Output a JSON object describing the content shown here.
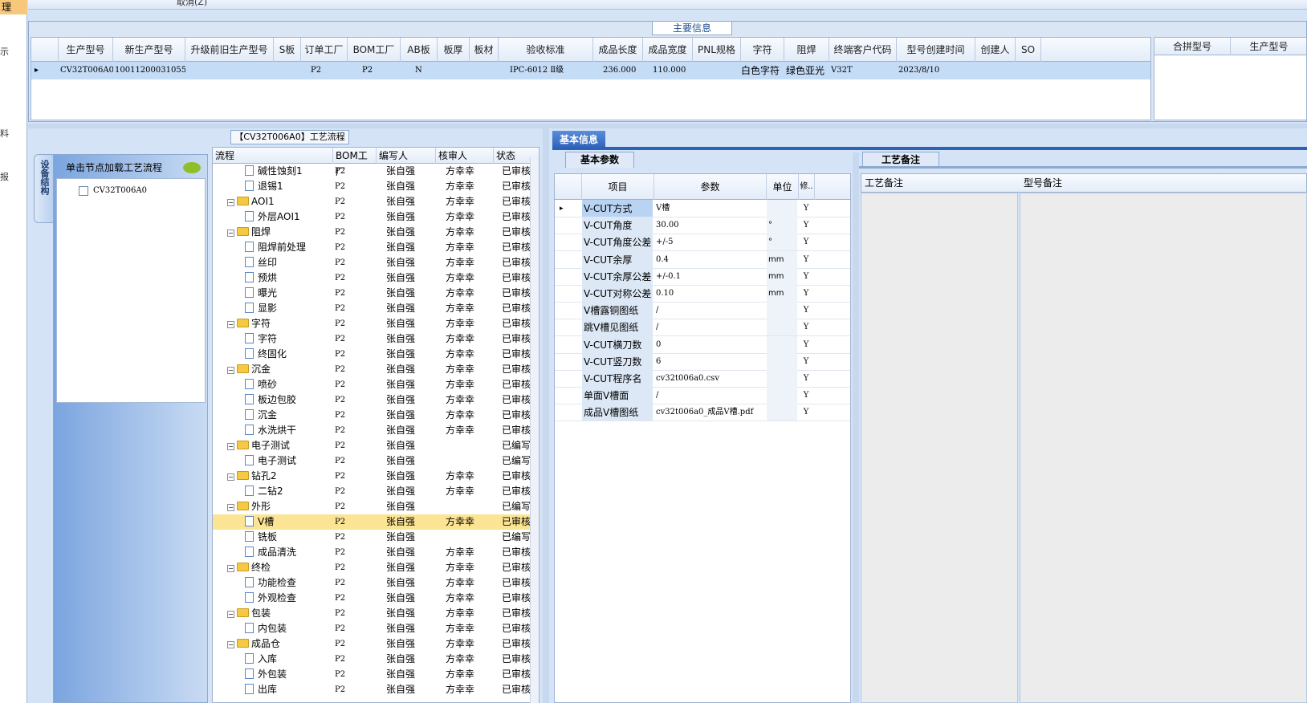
{
  "left_strip": {
    "tab": "理",
    "chars": [
      "示",
      "料",
      "报"
    ]
  },
  "toolbar": {
    "cancel_label": "取消(Z)"
  },
  "main_info": {
    "title": "主要信息",
    "columns": [
      "生产型号",
      "新生产型号",
      "升级前旧生产型号",
      "S板",
      "订单工厂",
      "BOM工厂",
      "AB板",
      "板厚",
      "板材",
      "验收标准",
      "成品长度",
      "成品宽度",
      "PNL规格",
      "字符",
      "阻焊",
      "终端客户代码",
      "型号创建时间",
      "创建人",
      "SO"
    ],
    "row": {
      "prod_model": "CV32T006A0",
      "new_model": "10011200031055",
      "order_factory": "P2",
      "bom_factory": "P2",
      "ab": "N",
      "standard": "IPC-6012 Ⅱ级",
      "length": "236.000",
      "width": "110.000",
      "char": "白色字符",
      "mask": "绿色亚光",
      "customer": "V32T",
      "created": "2023/8/10"
    },
    "merge_columns": [
      "合拼型号",
      "生产型号"
    ]
  },
  "workflow": {
    "title": "【CV32T006A0】工艺流程",
    "side_tab": "设备结构",
    "node_hint": "单击节点加载工艺流程",
    "node_item": "CV32T006A0",
    "columns": [
      "流程",
      "BOM工厂",
      "编写人",
      "核审人",
      "状态"
    ],
    "rows": [
      {
        "name": "碱性蚀刻1",
        "type": "doc",
        "bom": "P2",
        "writer": "张自强",
        "reviewer": "方幸幸",
        "status": "已审核"
      },
      {
        "name": "退锡1",
        "type": "doc",
        "bom": "P2",
        "writer": "张自强",
        "reviewer": "方幸幸",
        "status": "已审核"
      },
      {
        "name": "AOI1",
        "type": "folder",
        "bom": "P2",
        "writer": "张自强",
        "reviewer": "方幸幸",
        "status": "已审核"
      },
      {
        "name": "外层AOI1",
        "type": "doc",
        "bom": "P2",
        "writer": "张自强",
        "reviewer": "方幸幸",
        "status": "已审核"
      },
      {
        "name": "阻焊",
        "type": "folder",
        "bom": "P2",
        "writer": "张自强",
        "reviewer": "方幸幸",
        "status": "已审核"
      },
      {
        "name": "阻焊前处理",
        "type": "doc",
        "bom": "P2",
        "writer": "张自强",
        "reviewer": "方幸幸",
        "status": "已审核"
      },
      {
        "name": "丝印",
        "type": "doc",
        "bom": "P2",
        "writer": "张自强",
        "reviewer": "方幸幸",
        "status": "已审核"
      },
      {
        "name": "预烘",
        "type": "doc",
        "bom": "P2",
        "writer": "张自强",
        "reviewer": "方幸幸",
        "status": "已审核"
      },
      {
        "name": "曝光",
        "type": "doc",
        "bom": "P2",
        "writer": "张自强",
        "reviewer": "方幸幸",
        "status": "已审核"
      },
      {
        "name": "显影",
        "type": "doc",
        "bom": "P2",
        "writer": "张自强",
        "reviewer": "方幸幸",
        "status": "已审核"
      },
      {
        "name": "字符",
        "type": "folder",
        "bom": "P2",
        "writer": "张自强",
        "reviewer": "方幸幸",
        "status": "已审核"
      },
      {
        "name": "字符",
        "type": "doc",
        "bom": "P2",
        "writer": "张自强",
        "reviewer": "方幸幸",
        "status": "已审核"
      },
      {
        "name": "终固化",
        "type": "doc",
        "bom": "P2",
        "writer": "张自强",
        "reviewer": "方幸幸",
        "status": "已审核"
      },
      {
        "name": "沉金",
        "type": "folder",
        "bom": "P2",
        "writer": "张自强",
        "reviewer": "方幸幸",
        "status": "已审核"
      },
      {
        "name": "喷砂",
        "type": "doc",
        "bom": "P2",
        "writer": "张自强",
        "reviewer": "方幸幸",
        "status": "已审核"
      },
      {
        "name": "板边包胶",
        "type": "doc",
        "bom": "P2",
        "writer": "张自强",
        "reviewer": "方幸幸",
        "status": "已审核"
      },
      {
        "name": "沉金",
        "type": "doc",
        "bom": "P2",
        "writer": "张自强",
        "reviewer": "方幸幸",
        "status": "已审核"
      },
      {
        "name": "水洗烘干",
        "type": "doc",
        "bom": "P2",
        "writer": "张自强",
        "reviewer": "方幸幸",
        "status": "已审核"
      },
      {
        "name": "电子测试",
        "type": "folder",
        "bom": "P2",
        "writer": "张自强",
        "reviewer": "",
        "status": "已编写"
      },
      {
        "name": "电子测试",
        "type": "doc",
        "bom": "P2",
        "writer": "张自强",
        "reviewer": "",
        "status": "已编写"
      },
      {
        "name": "钻孔2",
        "type": "folder",
        "bom": "P2",
        "writer": "张自强",
        "reviewer": "方幸幸",
        "status": "已审核"
      },
      {
        "name": "二钻2",
        "type": "doc",
        "bom": "P2",
        "writer": "张自强",
        "reviewer": "方幸幸",
        "status": "已审核"
      },
      {
        "name": "外形",
        "type": "folder",
        "bom": "P2",
        "writer": "张自强",
        "reviewer": "",
        "status": "已编写"
      },
      {
        "name": "V槽",
        "type": "doc",
        "bom": "P2",
        "writer": "张自强",
        "reviewer": "方幸幸",
        "status": "已审核",
        "selected": true
      },
      {
        "name": "铣板",
        "type": "doc",
        "bom": "P2",
        "writer": "张自强",
        "reviewer": "",
        "status": "已编写"
      },
      {
        "name": "成品清洗",
        "type": "doc",
        "bom": "P2",
        "writer": "张自强",
        "reviewer": "方幸幸",
        "status": "已审核"
      },
      {
        "name": "终检",
        "type": "folder",
        "bom": "P2",
        "writer": "张自强",
        "reviewer": "方幸幸",
        "status": "已审核"
      },
      {
        "name": "功能检查",
        "type": "doc",
        "bom": "P2",
        "writer": "张自强",
        "reviewer": "方幸幸",
        "status": "已审核"
      },
      {
        "name": "外观检查",
        "type": "doc",
        "bom": "P2",
        "writer": "张自强",
        "reviewer": "方幸幸",
        "status": "已审核"
      },
      {
        "name": "包装",
        "type": "folder",
        "bom": "P2",
        "writer": "张自强",
        "reviewer": "方幸幸",
        "status": "已审核"
      },
      {
        "name": "内包装",
        "type": "doc",
        "bom": "P2",
        "writer": "张自强",
        "reviewer": "方幸幸",
        "status": "已审核"
      },
      {
        "name": "成品仓",
        "type": "folder",
        "bom": "P2",
        "writer": "张自强",
        "reviewer": "方幸幸",
        "status": "已审核"
      },
      {
        "name": "入库",
        "type": "doc",
        "bom": "P2",
        "writer": "张自强",
        "reviewer": "方幸幸",
        "status": "已审核"
      },
      {
        "name": "外包装",
        "type": "doc",
        "bom": "P2",
        "writer": "张自强",
        "reviewer": "方幸幸",
        "status": "已审核"
      },
      {
        "name": "出库",
        "type": "doc",
        "bom": "P2",
        "writer": "张自强",
        "reviewer": "方幸幸",
        "status": "已审核"
      }
    ]
  },
  "basic_info": {
    "tab": "基本信息",
    "param_tab": "基本参数",
    "columns": [
      "项目",
      "参数",
      "单位",
      "修.."
    ],
    "rows": [
      {
        "item": "V-CUT方式",
        "value": "V槽",
        "unit": "",
        "flag": "Y"
      },
      {
        "item": "V-CUT角度",
        "value": "30.00",
        "unit": "°",
        "flag": "Y"
      },
      {
        "item": "V-CUT角度公差",
        "value": "+/-5",
        "unit": "°",
        "flag": "Y"
      },
      {
        "item": "V-CUT余厚",
        "value": "0.4",
        "unit": "mm",
        "flag": "Y"
      },
      {
        "item": "V-CUT余厚公差",
        "value": "+/-0.1",
        "unit": "mm",
        "flag": "Y"
      },
      {
        "item": "V-CUT对称公差",
        "value": "0.10",
        "unit": "mm",
        "flag": "Y"
      },
      {
        "item": "V槽露铜图纸",
        "value": "/",
        "unit": "",
        "flag": "Y"
      },
      {
        "item": "跳V槽见图纸",
        "value": "/",
        "unit": "",
        "flag": "Y"
      },
      {
        "item": "V-CUT横刀数",
        "value": "0",
        "unit": "",
        "flag": "Y"
      },
      {
        "item": "V-CUT竖刀数",
        "value": "6",
        "unit": "",
        "flag": "Y"
      },
      {
        "item": "V-CUT程序名",
        "value": "cv32t006a0.csv",
        "unit": "",
        "flag": "Y"
      },
      {
        "item": "单面V槽面",
        "value": "/",
        "unit": "",
        "flag": "Y"
      },
      {
        "item": "成品V槽图纸",
        "value": "cv32t006a0_成品V槽.pdf",
        "unit": "",
        "flag": "Y"
      }
    ]
  },
  "remarks": {
    "tab": "工艺备注",
    "col1": "工艺备注",
    "col2": "型号备注"
  }
}
